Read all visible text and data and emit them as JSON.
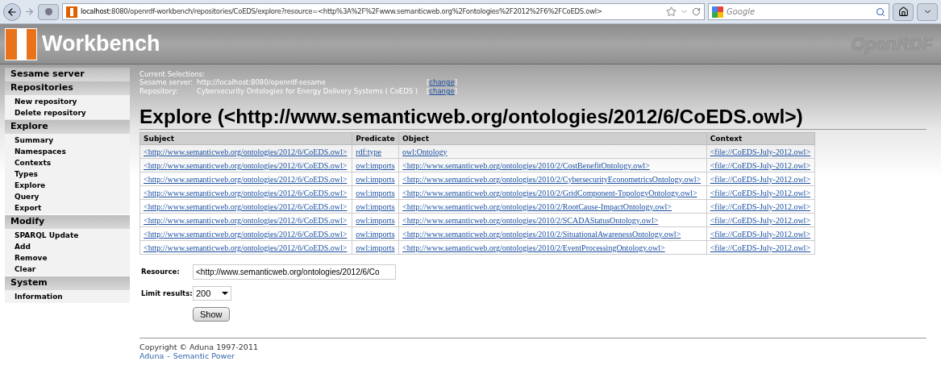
{
  "browser": {
    "url_host": "localhost",
    "url_path": ":8080/openrdf-workbench/repositories/CoEDS/explore?resource=<http%3A%2F%2Fwww.semanticweb.org%2Fontologies%2F2012%2F6%2FCoEDS.owl>",
    "search_placeholder": "Google"
  },
  "header": {
    "app_title": "Workbench",
    "brand": "OpenRDF"
  },
  "sidebar": [
    {
      "title": "Sesame server"
    },
    {
      "title": "Repositories",
      "items": [
        "New repository",
        "Delete repository"
      ]
    },
    {
      "title": "Explore",
      "items": [
        "Summary",
        "Namespaces",
        "Contexts",
        "Types",
        "Explore",
        "Query",
        "Export"
      ]
    },
    {
      "title": "Modify",
      "items": [
        "SPARQL Update",
        "Add",
        "Remove",
        "Clear"
      ]
    },
    {
      "title": "System",
      "items": [
        "Information"
      ]
    }
  ],
  "selections": {
    "heading": "Current Selections:",
    "rows": [
      {
        "label": "Sesame server:",
        "value": "http://localhost:8080/openrdf-sesame",
        "open": "[",
        "link": "change",
        "close": "]"
      },
      {
        "label": "Repository:",
        "value": "Cybersecurity Ontologies for Energy Delivery Systems ( CoEDS )",
        "open": "[",
        "link": "change",
        "close": "]"
      }
    ]
  },
  "title": "Explore (<http://www.semanticweb.org/ontologies/2012/6/CoEDS.owl>)",
  "table": {
    "columns": [
      "Subject",
      "Predicate",
      "Object",
      "Context"
    ],
    "rows": [
      [
        "<http://www.semanticweb.org/ontologies/2012/6/CoEDS.owl>",
        "rdf:type",
        "owl:Ontology",
        "<file://CoEDS-July-2012.owl>"
      ],
      [
        "<http://www.semanticweb.org/ontologies/2012/6/CoEDS.owl>",
        "owl:imports",
        "<http://www.semanticweb.org/ontologies/2010/2/CostBenefitOntology.owl>",
        "<file://CoEDS-July-2012.owl>"
      ],
      [
        "<http://www.semanticweb.org/ontologies/2012/6/CoEDS.owl>",
        "owl:imports",
        "<http://www.semanticweb.org/ontologies/2010/2/CybersecurityEconometricsOntology.owl>",
        "<file://CoEDS-July-2012.owl>"
      ],
      [
        "<http://www.semanticweb.org/ontologies/2012/6/CoEDS.owl>",
        "owl:imports",
        "<http://www.semanticweb.org/ontologies/2010/2/GridComponent-TopologyOntology.owl>",
        "<file://CoEDS-July-2012.owl>"
      ],
      [
        "<http://www.semanticweb.org/ontologies/2012/6/CoEDS.owl>",
        "owl:imports",
        "<http://www.semanticweb.org/ontologies/2010/2/RootCause-ImpactOntology.owl>",
        "<file://CoEDS-July-2012.owl>"
      ],
      [
        "<http://www.semanticweb.org/ontologies/2012/6/CoEDS.owl>",
        "owl:imports",
        "<http://www.semanticweb.org/ontologies/2010/2/SCADAStatusOntology.owl>",
        "<file://CoEDS-July-2012.owl>"
      ],
      [
        "<http://www.semanticweb.org/ontologies/2012/6/CoEDS.owl>",
        "owl:imports",
        "<http://www.semanticweb.org/ontologies/2010/2/SituationalAwarenessOntology.owl>",
        "<file://CoEDS-July-2012.owl>"
      ],
      [
        "<http://www.semanticweb.org/ontologies/2012/6/CoEDS.owl>",
        "owl:imports",
        "<http://www.semanticweb.org/ontologies/2010/2/EventProcessingOntology.owl>",
        "<file://CoEDS-July-2012.owl>"
      ]
    ]
  },
  "form": {
    "resource_label": "Resource:",
    "resource_value": "<http://www.semanticweb.org/ontologies/2012/6/Co",
    "limit_label": "Limit results:",
    "limit_value": "200",
    "show_button": "Show"
  },
  "footer": {
    "copyright": "Copyright © Aduna 1997-2011",
    "link_1": "Aduna",
    "separator": "-",
    "link_2": "Semantic Power"
  }
}
